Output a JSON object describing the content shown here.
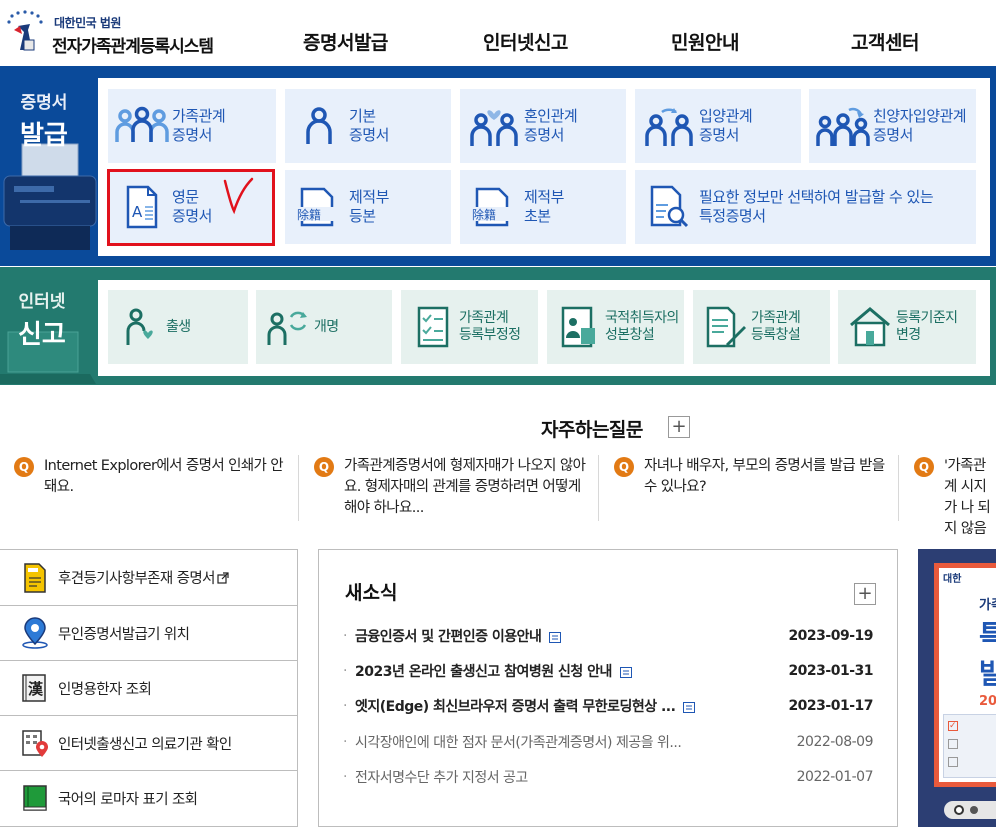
{
  "header": {
    "logo_sub": "대한민국 법원",
    "logo_main": "전자가족관계등록시스템",
    "nav": [
      "증명서발급",
      "인터넷신고",
      "민원안내",
      "고객센터"
    ]
  },
  "issue": {
    "label_small": "증명서",
    "label_large": "발급",
    "tiles": [
      {
        "label": "가족관계\n증명서",
        "icon": "family-three-icon"
      },
      {
        "label": "기본\n증명서",
        "icon": "person-icon"
      },
      {
        "label": "혼인관계\n증명서",
        "icon": "couple-heart-icon"
      },
      {
        "label": "입양관계\n증명서",
        "icon": "adoption-arrows-icon"
      },
      {
        "label": "친양자입양관계\n증명서",
        "icon": "family-arrows-icon"
      },
      {
        "label": "영문\n증명서",
        "icon": "english-document-icon"
      },
      {
        "label": "제적부\n등본",
        "icon": "removal-register-icon"
      },
      {
        "label": "제적부\n초본",
        "icon": "removal-register-icon"
      },
      {
        "label": "필요한 정보만 선택하여 발급할 수 있는\n특정증명서",
        "icon": "document-search-icon"
      }
    ],
    "tile_icon_text": "除籍",
    "doc_letter": "A",
    "annotation_mark": "V"
  },
  "report": {
    "label_small": "인터넷",
    "label_large": "신고",
    "tiles": [
      {
        "label": "출생",
        "icon": "birth-icon"
      },
      {
        "label": "개명",
        "icon": "name-change-icon"
      },
      {
        "label": "가족관계\n등록부정정",
        "icon": "register-correction-icon"
      },
      {
        "label": "국적취득자의\n성본창설",
        "icon": "nationality-icon"
      },
      {
        "label": "가족관계\n등록창설",
        "icon": "register-create-icon"
      },
      {
        "label": "등록기준지\n변경",
        "icon": "house-icon"
      }
    ]
  },
  "faq": {
    "title": "자주하는질문",
    "badge": "Q",
    "items": [
      "Internet Explorer에서 증명서 인쇄가 안돼요.",
      "가족관계증명서에 형제자매가 나오지 않아요. 형제자매의 관계를 증명하려면 어떻게 해야 하나요...",
      "자녀나 배우자, 부모의 증명서를 발급 받을 수 있나요?",
      "'가족관계 시지가 나 되지 않음"
    ]
  },
  "quick_links": [
    {
      "label": "후견등기사항부존재 증명서",
      "icon": "document-yellow-icon",
      "external": true
    },
    {
      "label": "무인증명서발급기 위치",
      "icon": "location-pin-icon",
      "external": false
    },
    {
      "label": "인명용한자 조회",
      "icon": "hanja-book-icon",
      "external": false
    },
    {
      "label": "인터넷출생신고 의료기관 확인",
      "icon": "hospital-location-icon",
      "external": false
    },
    {
      "label": "국어의 로마자 표기 조회",
      "icon": "green-book-icon",
      "external": false
    }
  ],
  "hanja_char": "漢",
  "news": {
    "title": "새소식",
    "items": [
      {
        "title": "금융인증서 및 간편인증 이용안내",
        "date": "2023-09-19",
        "bold": true,
        "icon": true
      },
      {
        "title": "2023년 온라인 출생신고 참여병원 신청 안내",
        "date": "2023-01-31",
        "bold": true,
        "icon": true
      },
      {
        "title": "엣지(Edge) 최신브라우저 증명서 출력 무한로딩현상 ...",
        "date": "2023-01-17",
        "bold": true,
        "icon": true
      },
      {
        "title": "시각장애인에 대한 점자 문서(가족관계증명서) 제공을 위...",
        "date": "2022-08-09",
        "bold": false,
        "icon": false
      },
      {
        "title": "전자서명수단 추가 지정서 공고",
        "date": "2022-01-07",
        "bold": false,
        "icon": false
      }
    ]
  },
  "banner": {
    "logo_text": "대한",
    "line1": "가족",
    "line2": "특",
    "line3": "발",
    "line4": "20"
  },
  "colors": {
    "issue_bg": "#0a4a9a",
    "report_bg": "#237a6f",
    "tile_blue": "#1f57b4",
    "tile_green": "#1c6f63",
    "faq_badge": "#e27a14",
    "highlight_red": "#e1111c"
  }
}
